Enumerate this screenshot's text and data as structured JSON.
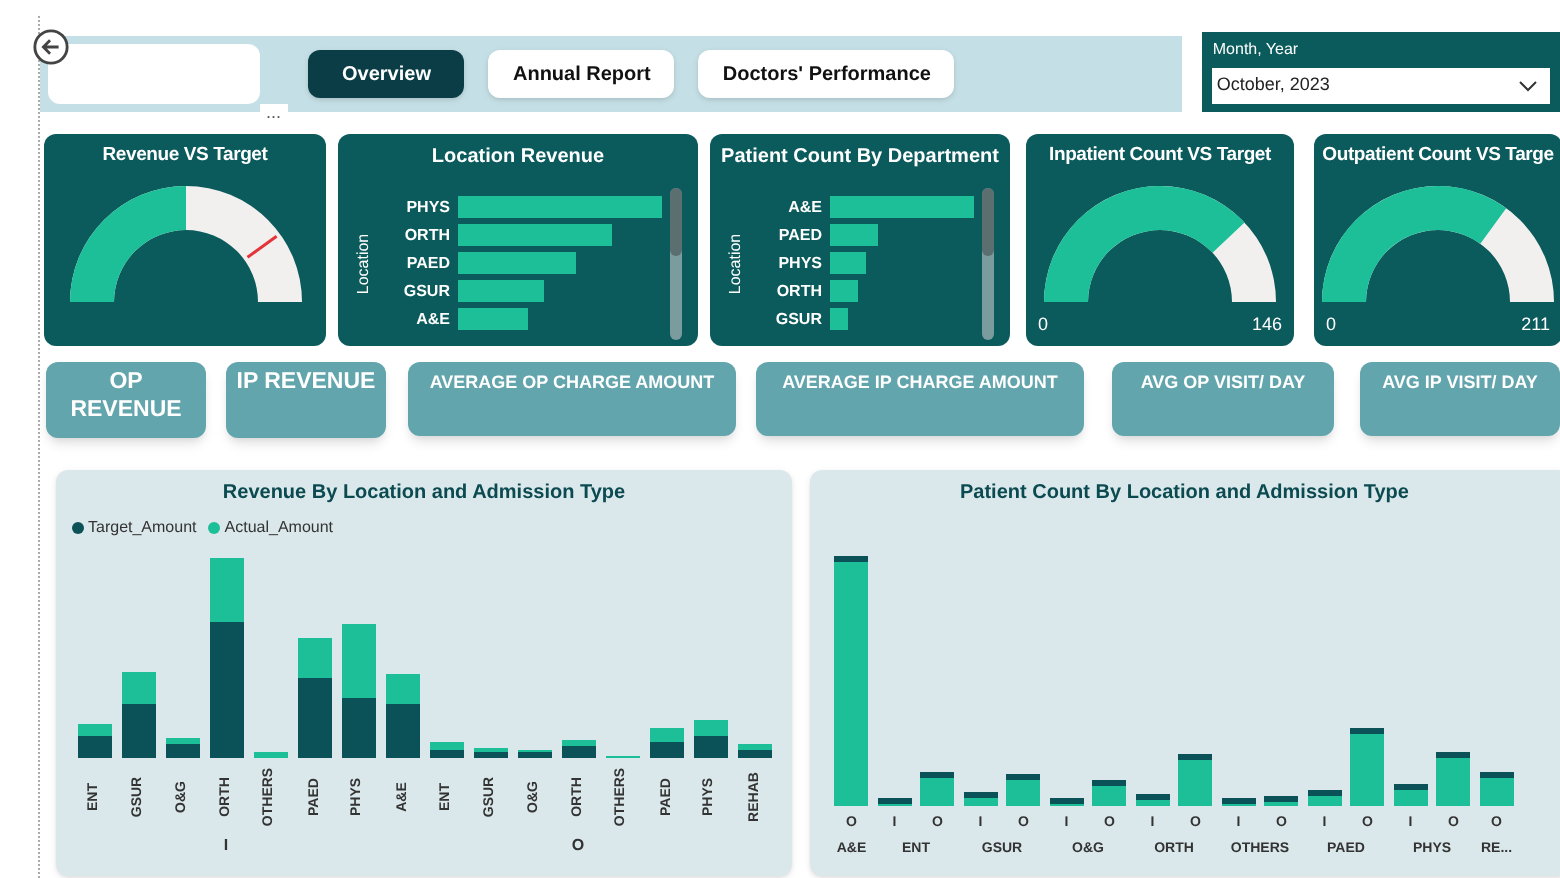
{
  "header": {
    "more_options": "...",
    "tabs": [
      {
        "label": "Overview",
        "selected": true
      },
      {
        "label": "Annual Report",
        "selected": false
      },
      {
        "label": "Doctors' Performance",
        "selected": false
      }
    ]
  },
  "slicer": {
    "label": "Month, Year",
    "value": "October, 2023"
  },
  "cards": [
    {
      "kind": "gauge",
      "title": "Revenue VS Target",
      "target_marker": true
    },
    {
      "kind": "bars",
      "title": "Location Revenue",
      "axis_label": "Location",
      "items": [
        "PHYS",
        "ORTH",
        "PAED",
        "GSUR",
        "A&E"
      ]
    },
    {
      "kind": "bars",
      "title": "Patient Count By Department",
      "axis_label": "Location",
      "items": [
        "A&E",
        "PAED",
        "PHYS",
        "ORTH",
        "GSUR"
      ]
    },
    {
      "kind": "gauge",
      "title": "Inpatient Count VS Target",
      "target_marker": false,
      "min": "0",
      "max": "146"
    },
    {
      "kind": "gauge",
      "title": "Outpatient Count VS Targe",
      "target_marker": false,
      "min": "0",
      "max": "211"
    }
  ],
  "kpi_buttons": [
    "OP REVENUE",
    "IP REVENUE",
    "AVERAGE OP CHARGE AMOUNT",
    "AVERAGE IP CHARGE AMOUNT",
    "AVG OP VISIT/ DAY",
    "AVG IP VISIT/ DAY"
  ],
  "revenue_chart": {
    "title": "Revenue By Location and Admission Type",
    "legend": [
      {
        "name": "Target_Amount",
        "color": "#0a5257"
      },
      {
        "name": "Actual_Amount",
        "color": "#1dbf98"
      }
    ],
    "groups": [
      {
        "label": "I",
        "categories": [
          "ENT",
          "GSUR",
          "O&G",
          "ORTH",
          "OTHERS",
          "PAED",
          "PHYS"
        ]
      },
      {
        "label": "O",
        "categories": [
          "A&E",
          "ENT",
          "GSUR",
          "O&G",
          "ORTH",
          "OTHERS",
          "PAED",
          "PHYS",
          "REHAB"
        ]
      }
    ]
  },
  "patient_chart": {
    "title": "Patient Count By Location and Admission Type",
    "groups": [
      {
        "label": "A&E",
        "types": [
          "O"
        ]
      },
      {
        "label": "ENT",
        "types": [
          "I",
          "O"
        ]
      },
      {
        "label": "GSUR",
        "types": [
          "I",
          "O"
        ]
      },
      {
        "label": "O&G",
        "types": [
          "I",
          "O"
        ]
      },
      {
        "label": "ORTH",
        "types": [
          "I",
          "O"
        ]
      },
      {
        "label": "OTHERS",
        "types": [
          "I",
          "O"
        ]
      },
      {
        "label": "PAED",
        "types": [
          "I",
          "O"
        ]
      },
      {
        "label": "PHYS",
        "types": [
          "I",
          "O"
        ]
      },
      {
        "label": "RE...",
        "types": [
          "O"
        ]
      }
    ]
  }
}
